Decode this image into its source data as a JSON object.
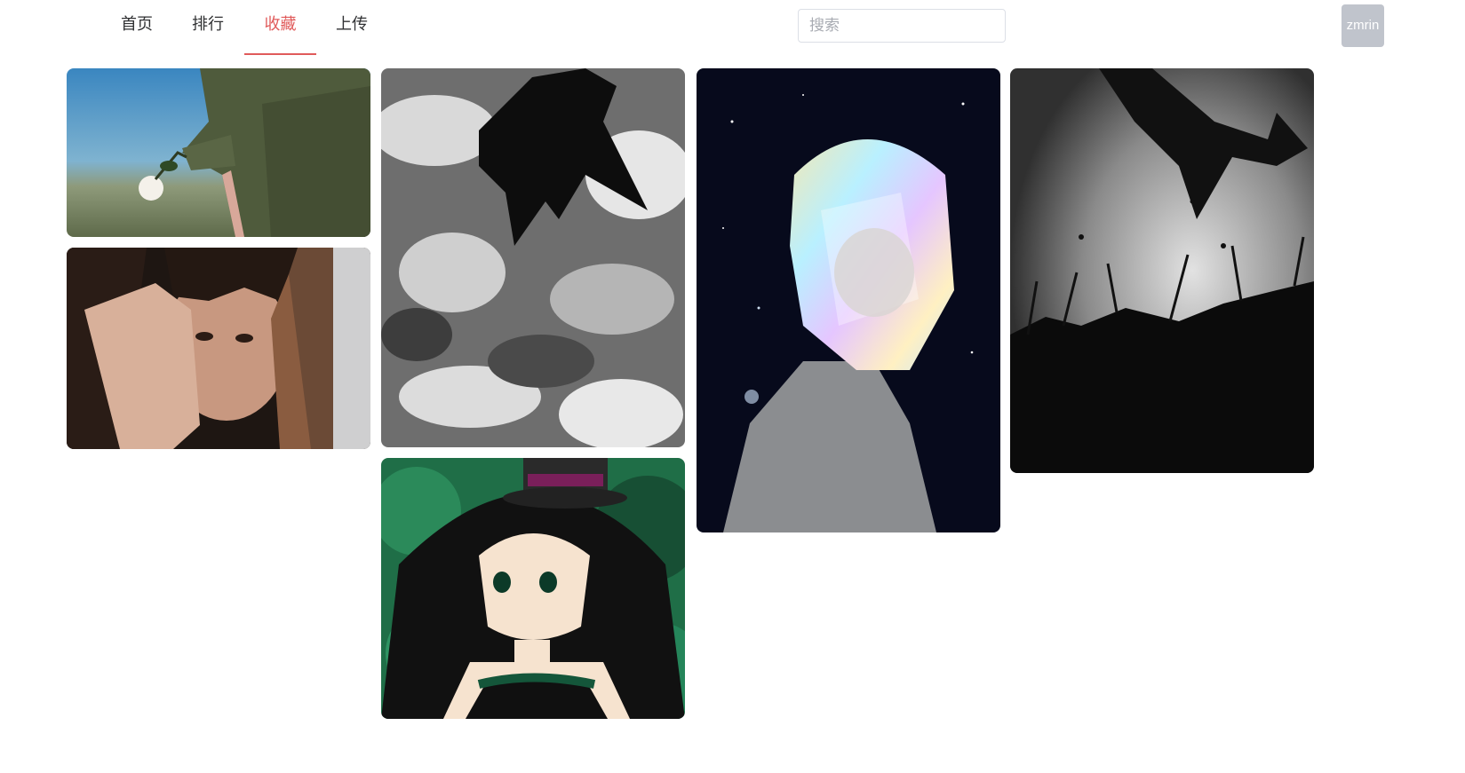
{
  "nav": {
    "items": [
      {
        "label": "首页"
      },
      {
        "label": "排行"
      },
      {
        "label": "收藏",
        "active": true
      },
      {
        "label": "上传"
      }
    ],
    "accent_color": "#e05a5a"
  },
  "search": {
    "placeholder": "搜索",
    "value": ""
  },
  "user": {
    "avatar_text": "zmrin"
  },
  "gallery": {
    "images": [
      {
        "subject": "coat-and-white-flower"
      },
      {
        "subject": "girl-resting-head-on-hand"
      },
      {
        "subject": "black-crow-over-snow"
      },
      {
        "subject": "anime-girl-with-top-hat"
      },
      {
        "subject": "iridescent-wrapped-head-in-space"
      },
      {
        "subject": "crows-over-bare-trees"
      }
    ]
  }
}
